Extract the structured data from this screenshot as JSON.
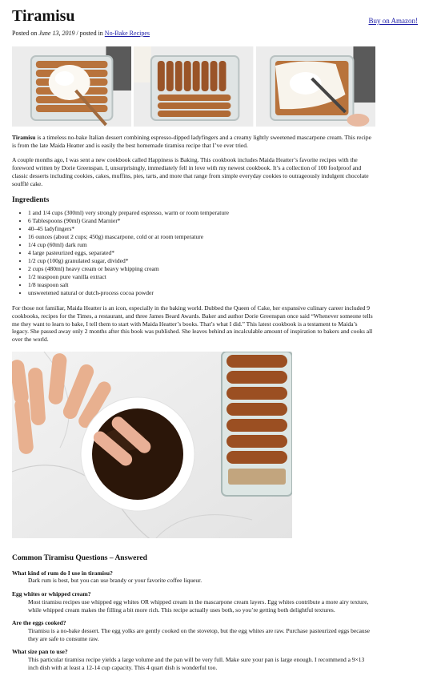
{
  "title": "Tiramisu",
  "buy_link": "Buy on Amazon!",
  "posted": {
    "prefix": "Posted on ",
    "date": "June 13, 2019",
    "middle": " / posted in ",
    "category": "No-Bake Recipes"
  },
  "intro": {
    "bold": "Tiramisu",
    "rest": " is a timeless no-bake Italian dessert combining espresso-dipped ladyfingers and a creamy lightly sweetened mascarpone cream. This recipe is from the late Maida Heatter and is easily the best homemade tiramisu recipe that I’ve ever tried."
  },
  "paragraph2": "A couple months ago, I was sent a new cookbook called Happiness is Baking. This cookbook includes Maida Heatter’s favorite recipes with the foreword written by Dorie Greenspan. I, unsurprisingly, immediately fell in love with my newest cookbook. It’s a collection of 100 foolproof and classic desserts including cookies, cakes, muffins, pies, tarts, and more that range from simple everyday cookies to outrageously indulgent chocolate soufflé cake.",
  "ingredients_heading": "Ingredients",
  "ingredients": [
    "1 and 1/4 cups (300ml) very strongly prepared espresso, warm or room temperature",
    "6 Tablespoons (90ml) Grand Marnier*",
    "40–45 ladyfingers*",
    "16 ounces (about 2 cups; 450g) mascarpone, cold or at room temperature",
    "1/4 cup (60ml) dark rum",
    "4 large pasteurized eggs, separated*",
    "1/2 cup (100g) granulated sugar, divided*",
    "2 cups (480ml) heavy cream or heavy whipping cream",
    "1/2 teaspoon pure vanilla extract",
    "1/8 teaspoon salt",
    "unsweetened natural or dutch-process cocoa powder"
  ],
  "paragraph3": "For those not familiar, Maida Heatter is an icon, especially in the baking world. Dubbed the Queen of Cake, her expansive culinary career included 9 cookbooks, recipes for the Times, a restaurant, and three James Beard Awards. Baker and author Dorie Greenspan once said “Whenever someone tells me they want to learn to bake, I tell them to start with Maida Heatter’s books. That’s what I did.” This latest cookbook is a testament to Maida’s legacy. She passed away only 2 months after this book was published. She leaves behind an incalculable amount of inspiration to bakers and cooks all over the world.",
  "faq_heading": "Common Tiramisu Questions – Answered",
  "faq": [
    {
      "q": "What kind of rum do I use in tiramisu?",
      "a": "Dark rum is best, but you can use brandy or your favorite coffee liqueur."
    },
    {
      "q": "Egg whites or whipped cream?",
      "a": "Most tiramisu recipes use whipped egg whites OR whipped cream in the mascarpone cream layers. Egg whites contribute a more airy texture, while whipped cream makes the filling a bit more rich. This recipe actually uses both, so you’re getting both delightful textures."
    },
    {
      "q": "Are the eggs cooked?",
      "a": "Tiramisu is a no-bake dessert. The egg yolks are gently cooked on the stovetop, but the egg whites are raw. Purchase pasteurized eggs because they are safe to consume raw."
    },
    {
      "q": "What size pan to use?",
      "a": "This particular tiramisu recipe yields a large volume and the pan will be very full. Make sure your pan is large enough. I recommend a 9×13 inch dish with at least a 12-14 cup capacity. This 4 quart dish is wonderful too."
    }
  ]
}
